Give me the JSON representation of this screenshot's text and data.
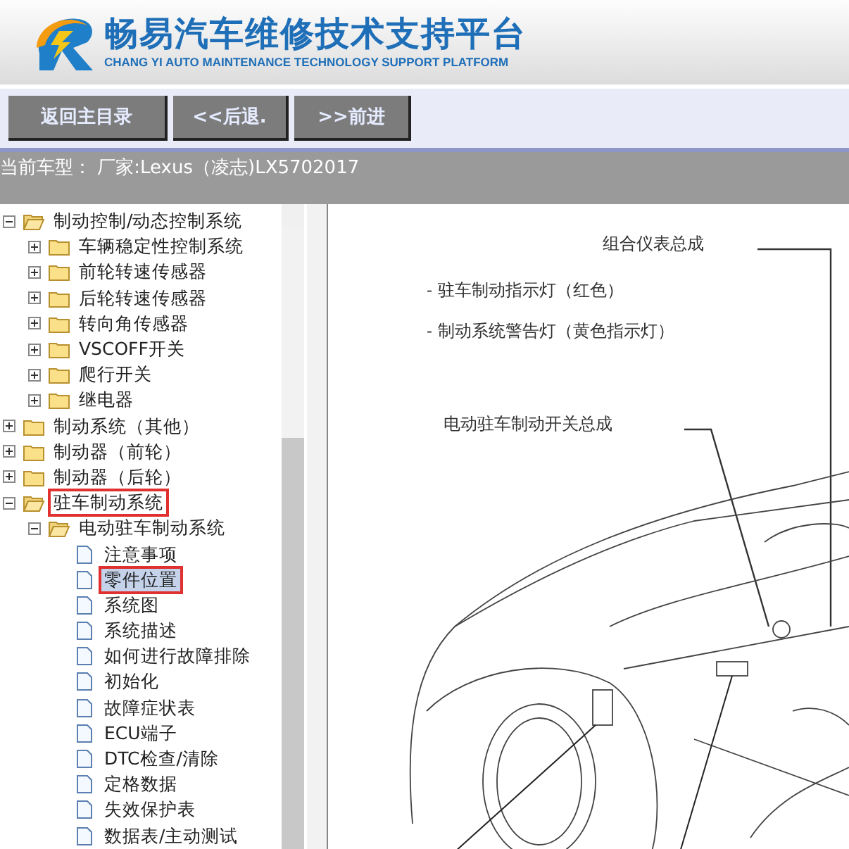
{
  "header": {
    "title": "畅易汽车维修技术支持平台",
    "subtitle": "CHANG YI AUTO MAINTENANCE TECHNOLOGY SUPPORT PLATFORM"
  },
  "toolbar": {
    "buttons": [
      "返回主目录",
      "<<后退.",
      ">>前进"
    ]
  },
  "vehicle_bar": {
    "text": "当前车型： 厂家:Lexus（凌志)LX5702017"
  },
  "tree": [
    {
      "label": "制动控制/动态控制系统",
      "kind": "folder",
      "expanded": true,
      "selected": false,
      "annotated": false,
      "children": [
        {
          "label": "车辆稳定性控制系统",
          "kind": "folder",
          "expanded": false,
          "selected": false,
          "annotated": false
        },
        {
          "label": "前轮转速传感器",
          "kind": "folder",
          "expanded": false,
          "selected": false,
          "annotated": false
        },
        {
          "label": "后轮转速传感器",
          "kind": "folder",
          "expanded": false,
          "selected": false,
          "annotated": false
        },
        {
          "label": "转向角传感器",
          "kind": "folder",
          "expanded": false,
          "selected": false,
          "annotated": false
        },
        {
          "label": "VSCOFF开关",
          "kind": "folder",
          "expanded": false,
          "selected": false,
          "annotated": false
        },
        {
          "label": "爬行开关",
          "kind": "folder",
          "expanded": false,
          "selected": false,
          "annotated": false
        },
        {
          "label": "继电器",
          "kind": "folder",
          "expanded": false,
          "selected": false,
          "annotated": false
        }
      ]
    },
    {
      "label": "制动系统（其他）",
      "kind": "folder",
      "expanded": false,
      "selected": false,
      "annotated": false
    },
    {
      "label": "制动器（前轮）",
      "kind": "folder",
      "expanded": false,
      "selected": false,
      "annotated": false
    },
    {
      "label": "制动器（后轮）",
      "kind": "folder",
      "expanded": false,
      "selected": false,
      "annotated": false
    },
    {
      "label": "驻车制动系统",
      "kind": "folder",
      "expanded": true,
      "selected": false,
      "annotated": true,
      "children": [
        {
          "label": "电动驻车制动系统",
          "kind": "folder",
          "expanded": true,
          "selected": false,
          "annotated": false,
          "children": [
            {
              "label": "注意事项",
              "kind": "page",
              "selected": false,
              "annotated": false
            },
            {
              "label": "零件位置",
              "kind": "page",
              "selected": true,
              "annotated": true
            },
            {
              "label": "系统图",
              "kind": "page",
              "selected": false,
              "annotated": false
            },
            {
              "label": "系统描述",
              "kind": "page",
              "selected": false,
              "annotated": false
            },
            {
              "label": "如何进行故障排除",
              "kind": "page",
              "selected": false,
              "annotated": false
            },
            {
              "label": "初始化",
              "kind": "page",
              "selected": false,
              "annotated": false
            },
            {
              "label": "故障症状表",
              "kind": "page",
              "selected": false,
              "annotated": false
            },
            {
              "label": "ECU端子",
              "kind": "page",
              "selected": false,
              "annotated": false
            },
            {
              "label": "DTC检查/清除",
              "kind": "page",
              "selected": false,
              "annotated": false
            },
            {
              "label": "定格数据",
              "kind": "page",
              "selected": false,
              "annotated": false
            },
            {
              "label": "失效保护表",
              "kind": "page",
              "selected": false,
              "annotated": false
            },
            {
              "label": "数据表/主动测试",
              "kind": "page",
              "selected": false,
              "annotated": false
            }
          ]
        }
      ]
    }
  ],
  "diagram": {
    "labels": [
      "组合仪表总成",
      "- 驻车制动指示灯（红色）",
      "- 制动系统警告灯（黄色指示灯）",
      "电动驻车制动开关总成"
    ]
  }
}
